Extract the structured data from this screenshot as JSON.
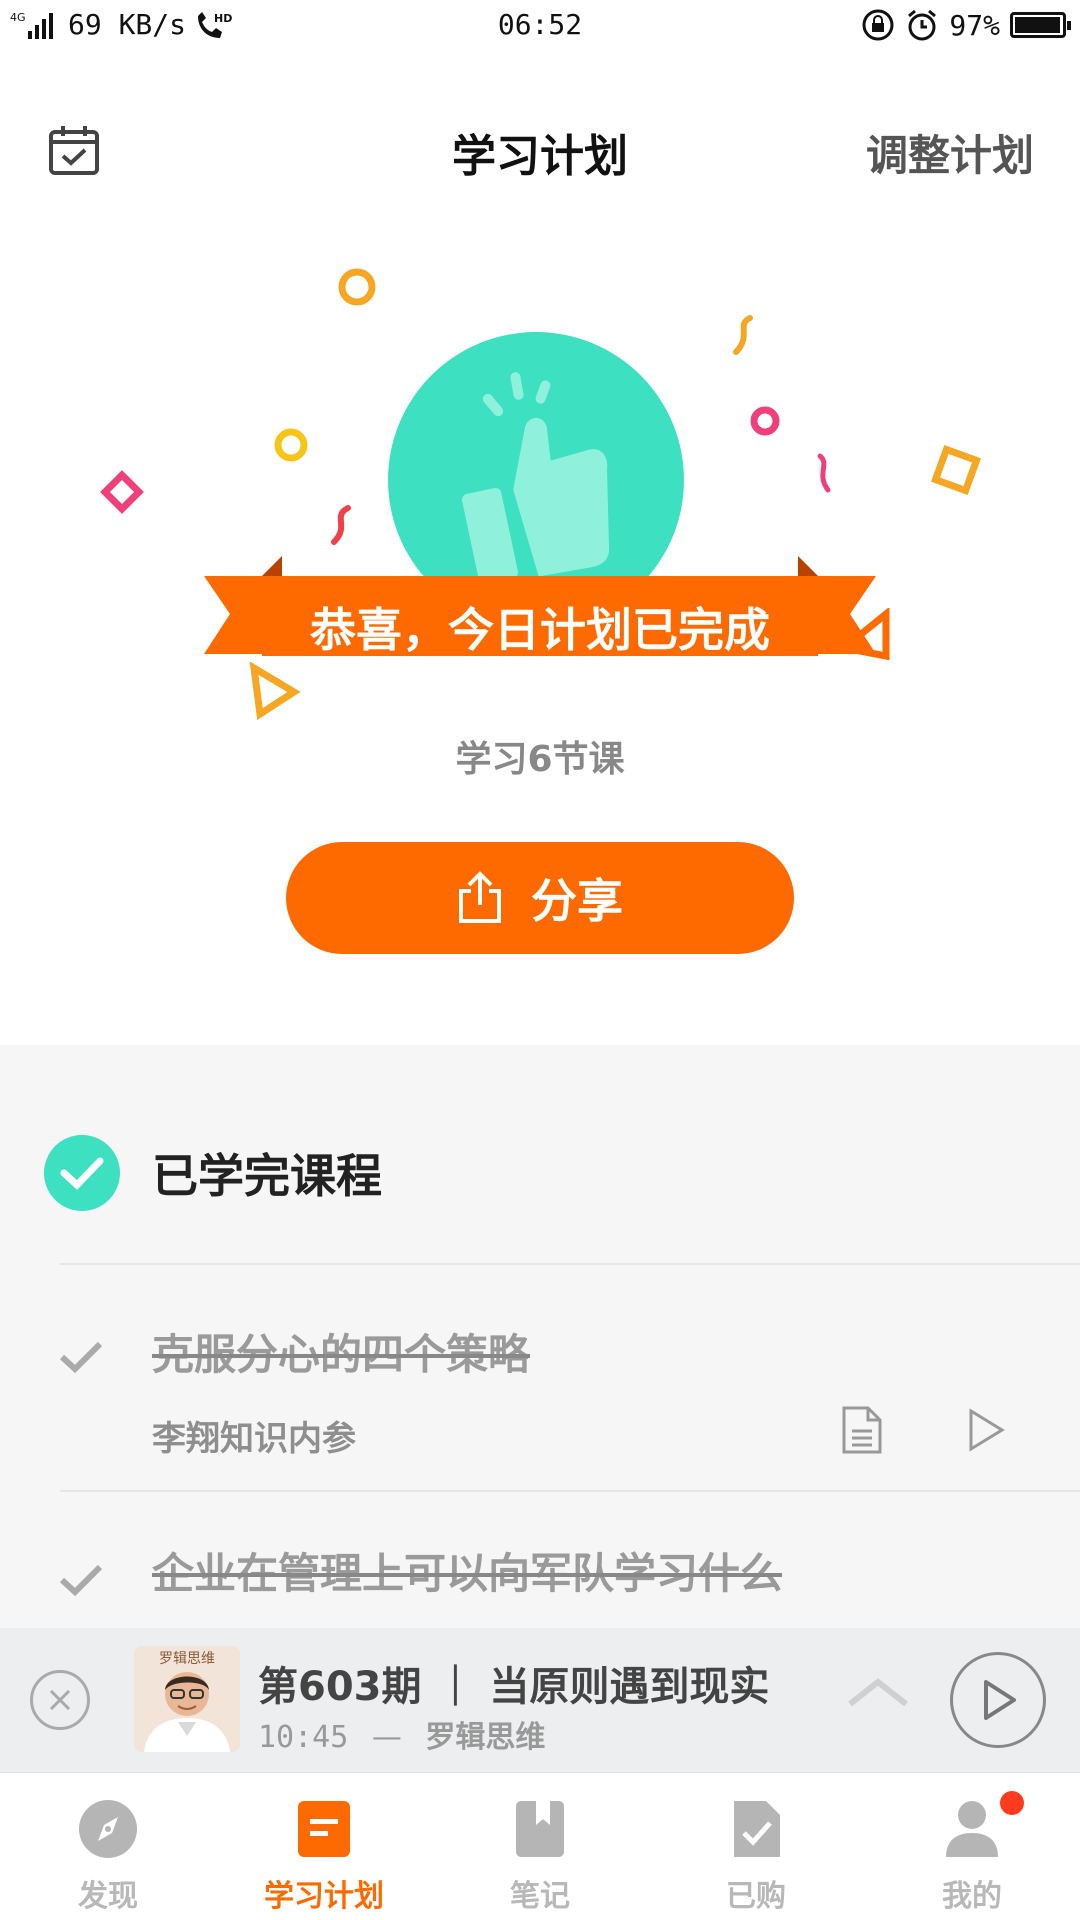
{
  "status_bar": {
    "network": "4G",
    "speed": "69 KB/s",
    "hd": "HD",
    "time": "06:52",
    "battery_percent": "97%",
    "battery_level": 0.97
  },
  "header": {
    "title": "学习计划",
    "adjust_label": "调整计划",
    "calendar_icon": "calendar-check-icon"
  },
  "hero": {
    "banner_text": "恭喜，今日计划已完成",
    "summary": "学习6节课",
    "share_label": "分享",
    "colors": {
      "circle": "#3de0c0",
      "ribbon": "#ff6a00",
      "accent": "#ff6a00"
    }
  },
  "completed": {
    "section_title": "已学完课程",
    "courses": [
      {
        "title": "克服分心的四个策略",
        "author": "李翔知识内参"
      },
      {
        "title": "企业在管理上可以向军队学习什么"
      }
    ]
  },
  "player": {
    "thumb_label": "罗辑思维",
    "episode_title": "第603期 ｜ 当原则遇到现实",
    "time": "10:45",
    "separator": "—",
    "host": "罗辑思维"
  },
  "tabs": [
    {
      "label": "发现",
      "icon": "compass-icon",
      "active": false
    },
    {
      "label": "学习计划",
      "icon": "plan-icon",
      "active": true
    },
    {
      "label": "笔记",
      "icon": "bookmark-icon",
      "active": false
    },
    {
      "label": "已购",
      "icon": "purchased-icon",
      "active": false
    },
    {
      "label": "我的",
      "icon": "profile-icon",
      "active": false,
      "badge": true
    }
  ]
}
